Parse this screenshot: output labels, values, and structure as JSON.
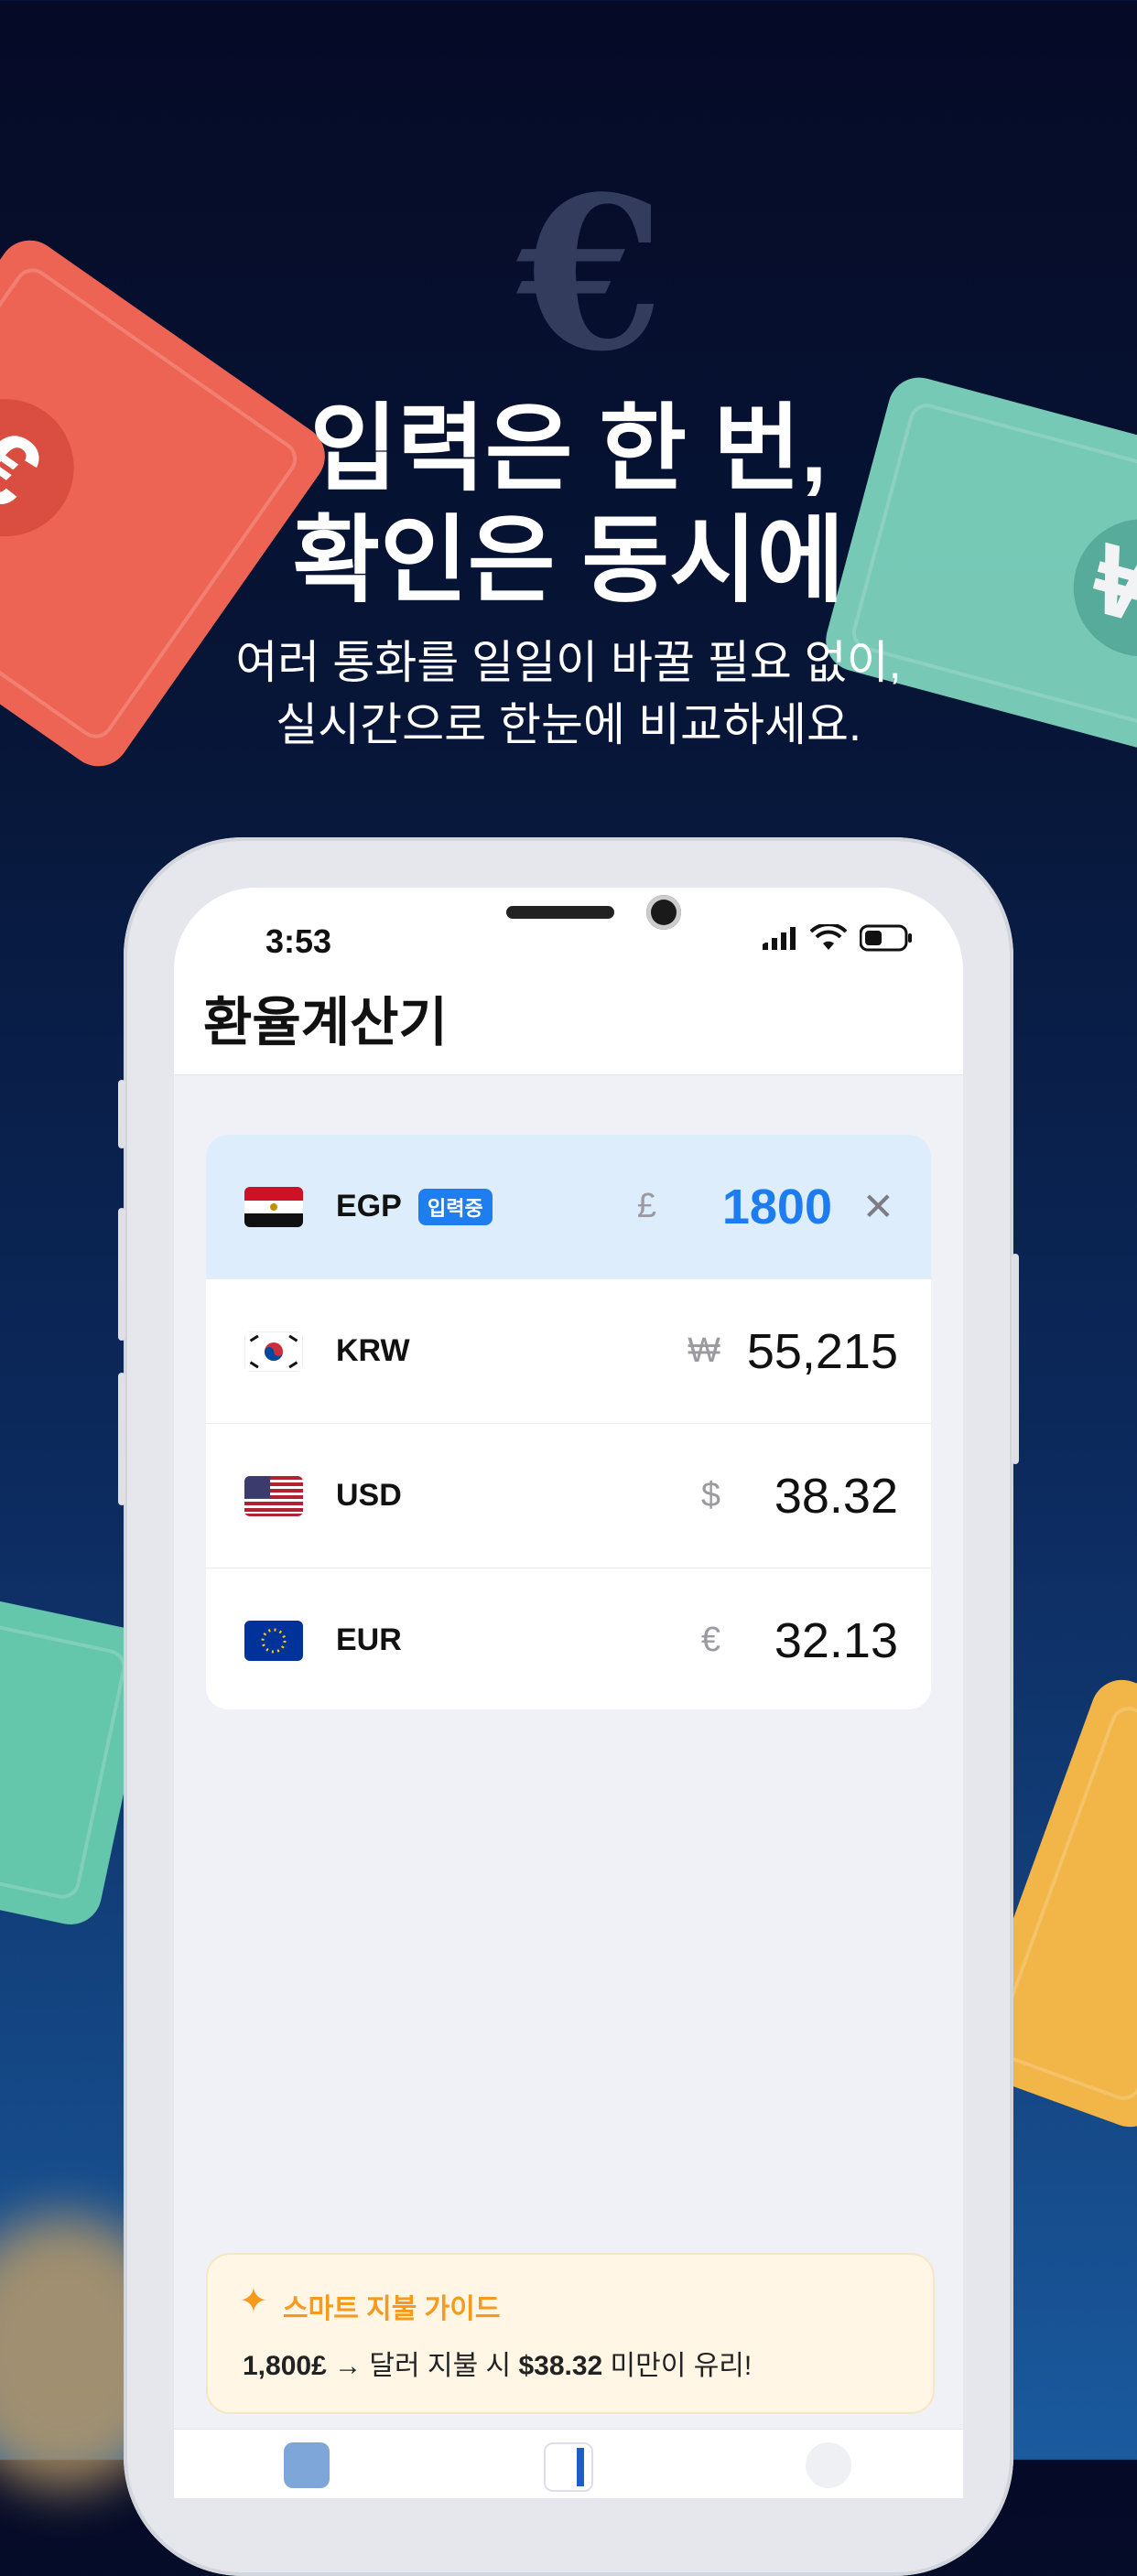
{
  "headline": {
    "line1": "입력은 한 번,",
    "line2": "확인은 동시에"
  },
  "subline": {
    "line1": "여러 통화를 일일이 바꿀 필요 없이,",
    "line2": "실시간으로 한눈에 비교하세요."
  },
  "decor": {
    "euro_symbol": "€",
    "won_symbol": "₩"
  },
  "status_bar": {
    "time": "3:53"
  },
  "app": {
    "title": "환율계산기"
  },
  "currencies": [
    {
      "code": "EGP",
      "badge": "입력중",
      "symbol": "£",
      "amount": "1800",
      "active": true,
      "clear": "✕"
    },
    {
      "code": "KRW",
      "symbol": "₩",
      "amount": "55,215",
      "active": false
    },
    {
      "code": "USD",
      "symbol": "$",
      "amount": "38.32",
      "active": false
    },
    {
      "code": "EUR",
      "symbol": "€",
      "amount": "32.13",
      "active": false
    }
  ],
  "guide": {
    "title": "스마트 지불 가이드",
    "amount": "1,800£",
    "arrow_text": " → 달러 지불 시 ",
    "threshold": "$38.32",
    "tail": " 미만이 유리!"
  },
  "colors": {
    "accent": "#1d7df0",
    "guide_orange": "#f59a1c"
  }
}
